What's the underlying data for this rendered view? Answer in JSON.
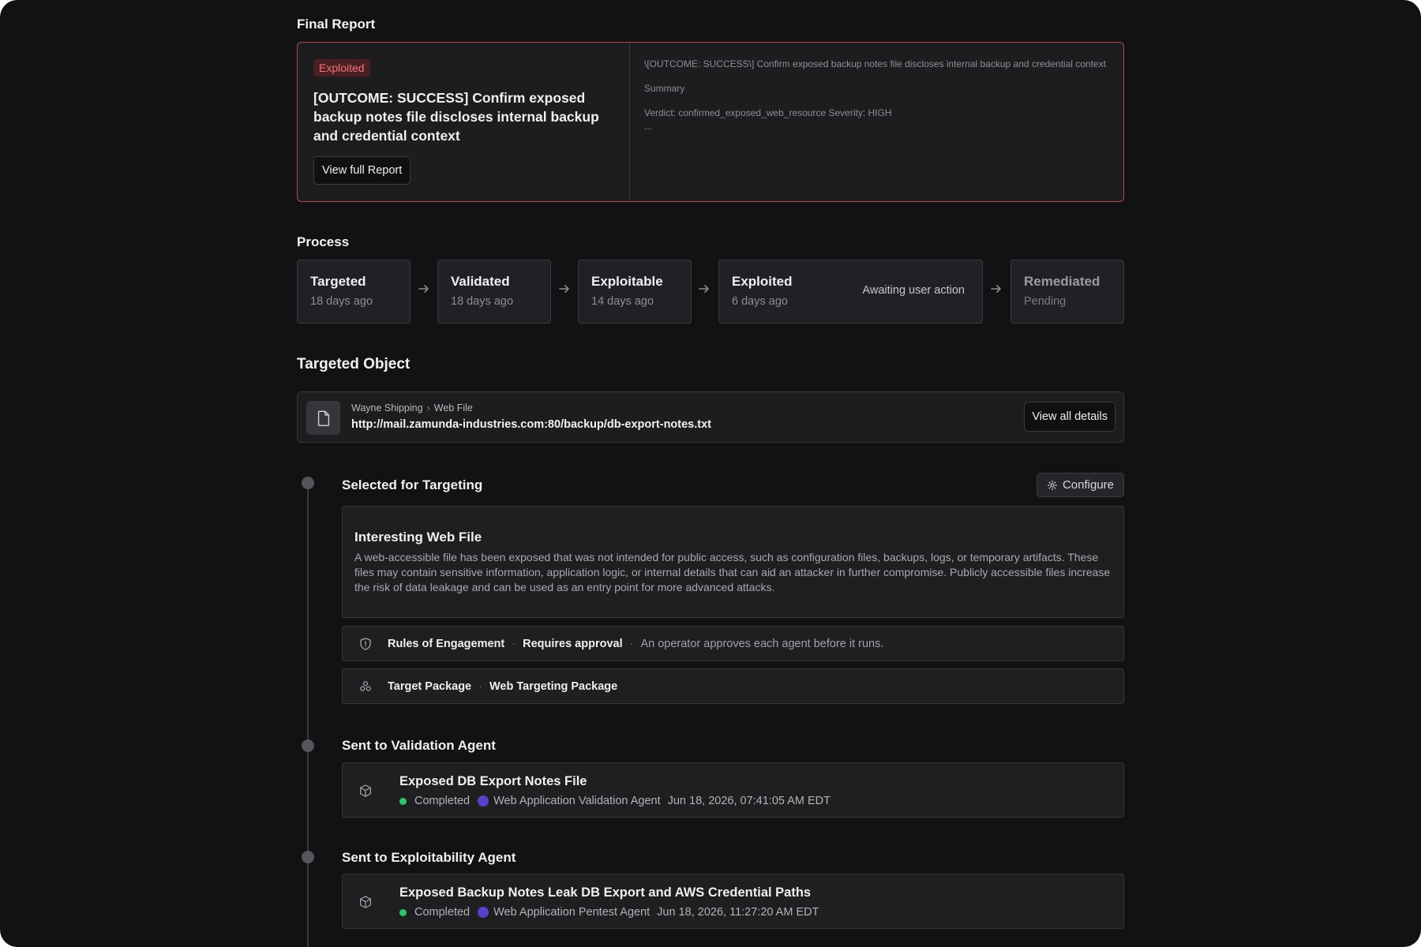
{
  "final_report": {
    "heading": "Final Report",
    "badge": "Exploited",
    "title": "[OUTCOME: SUCCESS] Confirm exposed backup notes file discloses internal backup and credential context",
    "button": "View full Report",
    "preview_line1": "\\[OUTCOME: SUCCESS\\] Confirm exposed backup notes file discloses internal backup and credential context",
    "preview_line2": "Summary",
    "preview_line3": "Verdict: confirmed_exposed_web_resource Severity: HIGH",
    "preview_line4": "..."
  },
  "process": {
    "heading": "Process",
    "steps": [
      {
        "name": "Targeted",
        "sub": "18 days ago"
      },
      {
        "name": "Validated",
        "sub": "18 days ago"
      },
      {
        "name": "Exploitable",
        "sub": "14 days ago"
      },
      {
        "name": "Exploited",
        "sub": "6 days ago",
        "aside": "Awaiting user action"
      },
      {
        "name": "Remediated",
        "sub": "Pending"
      }
    ]
  },
  "targeted_object": {
    "heading": "Targeted Object",
    "icon": "file-icon",
    "breadcrumb": [
      "Wayne Shipping",
      "Web File"
    ],
    "url": "http://mail.zamunda-industries.com:80/backup/db-export-notes.txt",
    "button": "View all details"
  },
  "timeline": {
    "selected": {
      "title": "Selected for Targeting",
      "configure": "Configure",
      "finding_title": "Interesting Web File",
      "finding_desc": "A web-accessible file has been exposed that was not intended for public access, such as configuration files, backups, logs, or temporary artifacts. These files may contain sensitive information, application logic, or internal details that can aid an attacker in further compromise. Publicly accessible files increase the risk of data leakage and can be used as an entry point for more advanced attacks.",
      "roe_label": "Rules of Engagement",
      "roe_value": "Requires approval",
      "roe_note": "An operator approves each agent before it runs.",
      "pkg_label": "Target Package",
      "pkg_value": "Web Targeting Package"
    },
    "validation": {
      "title": "Sent to Validation Agent",
      "card_title": "Exposed DB Export Notes File",
      "status": "Completed",
      "agent": "Web Application Validation Agent",
      "timestamp": "Jun 18, 2026, 07:41:05 AM EDT"
    },
    "exploitability": {
      "title": "Sent to Exploitability Agent",
      "card_title": "Exposed Backup Notes Leak DB Export and AWS Credential Paths",
      "status": "Completed",
      "agent": "Web Application Pentest Agent",
      "timestamp": "Jun 18, 2026, 11:27:20 AM EDT"
    }
  },
  "colors": {
    "background": "#121214",
    "card": "#1f1f22",
    "exploited_accent": "#ef7676",
    "report_border": "#b34a4a",
    "status_green": "#2ec46a",
    "agent_purple": "#5b3fc9"
  }
}
